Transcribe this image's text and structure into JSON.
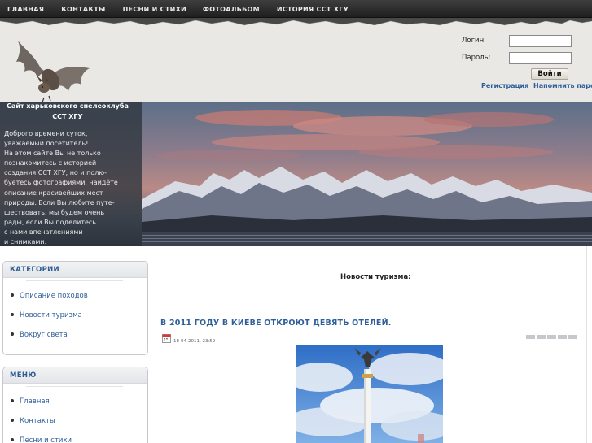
{
  "nav": {
    "items": [
      "ГЛАВНАЯ",
      "КОНТАКТЫ",
      "ПЕСНИ И СТИХИ",
      "ФОТОАЛЬБОМ",
      "ИСТОРИЯ СCT ХГУ"
    ]
  },
  "login": {
    "login_label": "Логин:",
    "password_label": "Пароль:",
    "login_value": "",
    "password_value": "",
    "submit_label": "Войти",
    "register_link": "Регистрация",
    "remind_link": "Напомнить пароль?"
  },
  "intro": {
    "title": "Сайт харьковского спелеоклуба СCT ХГУ",
    "text_lines": [
      "Доброго времени суток,",
      "уважаемый посетитель!",
      "На этом сайте Вы не только",
      "познакомитесь с историей",
      "создания СCT ХГУ, но и полю-",
      "буетесь фотографиями, найдёте",
      "описание красивейших мест",
      "природы. Если Вы любите путе-",
      "шествовать, мы будем очень",
      "рады, если Вы поделитесь",
      "с нами впечатлениями",
      "и снимками."
    ]
  },
  "sidebar": {
    "categories": {
      "title": "КАТЕГОРИИ",
      "items": [
        "Описание походов",
        "Новости туризма",
        "Вокруг света"
      ]
    },
    "menu": {
      "title": "МЕНЮ",
      "items": [
        "Главная",
        "Контакты",
        "Песни и стихи"
      ]
    }
  },
  "main": {
    "heading": "Новости туризма:",
    "article": {
      "title": "В 2011 ГОДУ В КИЕВЕ ОТКРОЮТ ДЕВЯТЬ ОТЕЛЕЙ.",
      "date": "18-04-2011, 23:59",
      "calendar_icon": "calendar-icon"
    }
  },
  "colors": {
    "nav_bg": "#2b2b2b",
    "header_bg": "#e9e8e4",
    "link": "#2f5f9a",
    "box_title": "#2d5d93"
  }
}
